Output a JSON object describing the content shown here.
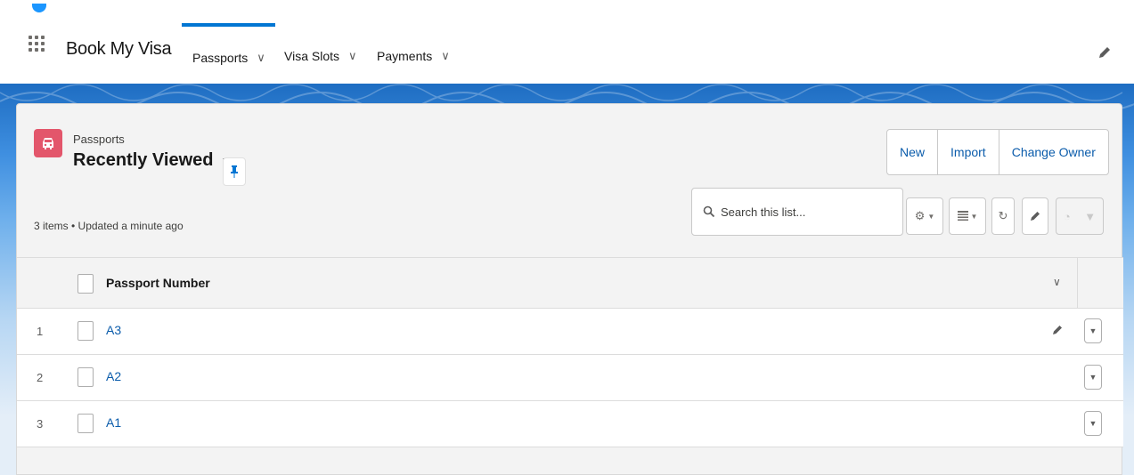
{
  "app": {
    "name": "Book My Visa"
  },
  "nav": {
    "tabs": [
      {
        "label": "Passports",
        "active": true
      },
      {
        "label": "Visa Slots",
        "active": false
      },
      {
        "label": "Payments",
        "active": false
      }
    ]
  },
  "list": {
    "object_label": "Passports",
    "view_name": "Recently Viewed",
    "meta": "3 items • Updated a minute ago",
    "actions": {
      "new": "New",
      "import": "Import",
      "change_owner": "Change Owner"
    },
    "search_placeholder": "Search this list...",
    "column_header": "Passport Number",
    "rows": [
      {
        "num": "1",
        "value": "A3"
      },
      {
        "num": "2",
        "value": "A2"
      },
      {
        "num": "3",
        "value": "A1"
      }
    ]
  },
  "colors": {
    "accent": "#0176d3",
    "object_icon": "#e3566b",
    "link": "#0b5cab"
  },
  "icons": [
    "app-launcher-icon",
    "edit-pencil-icon",
    "car-icon",
    "pin-icon",
    "search-icon",
    "gear-icon",
    "table-icon",
    "refresh-icon",
    "chart-icon",
    "filter-icon",
    "chevron-down-icon"
  ]
}
